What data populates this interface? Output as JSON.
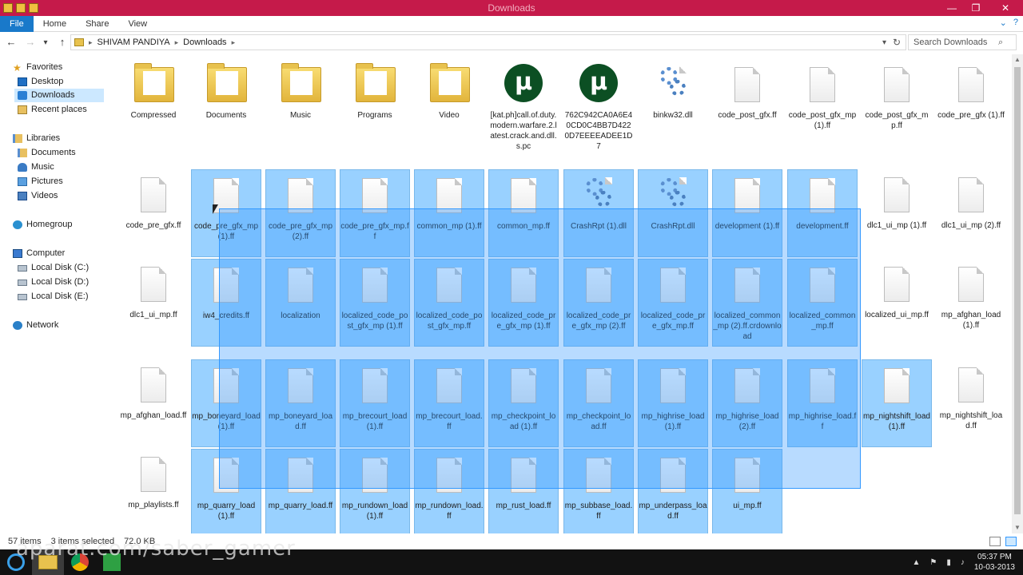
{
  "window": {
    "title": "Downloads",
    "buttons": {
      "minimize": "—",
      "maximize": "❐",
      "close": "✕"
    }
  },
  "ribbon": {
    "tabs": [
      "File",
      "Home",
      "Share",
      "View"
    ]
  },
  "address": {
    "crumbs": [
      "SHIVAM PANDIYA",
      "Downloads"
    ],
    "search_placeholder": "Search Downloads"
  },
  "nav": {
    "favorites": "Favorites",
    "desktop": "Desktop",
    "downloads": "Downloads",
    "recent": "Recent places",
    "libraries": "Libraries",
    "documents": "Documents",
    "music": "Music",
    "pictures": "Pictures",
    "videos": "Videos",
    "homegroup": "Homegroup",
    "computer": "Computer",
    "drive_c": "Local Disk (C:)",
    "drive_d": "Local Disk (D:)",
    "drive_e": "Local Disk (E:)",
    "network": "Network"
  },
  "files": [
    {
      "label": "Compressed",
      "icon": "folder-icon"
    },
    {
      "label": "Documents",
      "icon": "folder-icon"
    },
    {
      "label": "Music",
      "icon": "folder-icon"
    },
    {
      "label": "Programs",
      "icon": "folder-icon"
    },
    {
      "label": "Video",
      "icon": "folder-icon"
    },
    {
      "label": "[kat.ph]call.of.duty.modern.warfare.2.latest.crack.and.dll.s.pc",
      "icon": "utorrent-icon"
    },
    {
      "label": "762C942CA0A6E40CD0C4BB7D4220D7EEEEADEE1D7",
      "icon": "utorrent-icon"
    },
    {
      "label": "binkw32.dll",
      "icon": "settings-gear-icon"
    },
    {
      "label": "code_post_gfx.ff",
      "icon": "file-icon"
    },
    {
      "label": "code_post_gfx_mp (1).ff",
      "icon": "file-icon"
    },
    {
      "label": "code_post_gfx_mp.ff",
      "icon": "file-icon"
    },
    {
      "label": "code_pre_gfx (1).ff",
      "icon": "file-icon"
    },
    {
      "label": "code_pre_gfx.ff",
      "icon": "file-icon"
    },
    {
      "label": "code_pre_gfx_mp (1).ff",
      "icon": "file-icon"
    },
    {
      "label": "code_pre_gfx_mp (2).ff",
      "icon": "file-icon"
    },
    {
      "label": "code_pre_gfx_mp.ff",
      "icon": "file-icon"
    },
    {
      "label": "common_mp (1).ff",
      "icon": "file-icon"
    },
    {
      "label": "common_mp.ff",
      "icon": "file-icon"
    },
    {
      "label": "CrashRpt (1).dll",
      "icon": "settings-gear-icon"
    },
    {
      "label": "CrashRpt.dll",
      "icon": "settings-gear-icon"
    },
    {
      "label": "development (1).ff",
      "icon": "file-icon"
    },
    {
      "label": "development.ff",
      "icon": "file-icon"
    },
    {
      "label": "dlc1_ui_mp (1).ff",
      "icon": "file-icon"
    },
    {
      "label": "dlc1_ui_mp (2).ff",
      "icon": "file-icon"
    },
    {
      "label": "dlc1_ui_mp.ff",
      "icon": "file-icon"
    },
    {
      "label": "iw4_credits.ff",
      "icon": "file-icon"
    },
    {
      "label": "localization",
      "icon": "file-icon"
    },
    {
      "label": "localized_code_post_gfx_mp (1).ff",
      "icon": "file-icon"
    },
    {
      "label": "localized_code_post_gfx_mp.ff",
      "icon": "file-icon"
    },
    {
      "label": "localized_code_pre_gfx_mp (1).ff",
      "icon": "file-icon"
    },
    {
      "label": "localized_code_pre_gfx_mp (2).ff",
      "icon": "file-icon"
    },
    {
      "label": "localized_code_pre_gfx_mp.ff",
      "icon": "file-icon"
    },
    {
      "label": "localized_common_mp (2).ff.crdownload",
      "icon": "file-icon"
    },
    {
      "label": "localized_common_mp.ff",
      "icon": "file-icon"
    },
    {
      "label": "localized_ui_mp.ff",
      "icon": "file-icon"
    },
    {
      "label": "mp_afghan_load (1).ff",
      "icon": "file-icon"
    },
    {
      "label": "mp_afghan_load.ff",
      "icon": "file-icon"
    },
    {
      "label": "mp_boneyard_load (1).ff",
      "icon": "file-icon"
    },
    {
      "label": "mp_boneyard_load.ff",
      "icon": "file-icon"
    },
    {
      "label": "mp_brecourt_load (1).ff",
      "icon": "file-icon"
    },
    {
      "label": "mp_brecourt_load.ff",
      "icon": "file-icon"
    },
    {
      "label": "mp_checkpoint_load (1).ff",
      "icon": "file-icon"
    },
    {
      "label": "mp_checkpoint_load.ff",
      "icon": "file-icon"
    },
    {
      "label": "mp_highrise_load (1).ff",
      "icon": "file-icon"
    },
    {
      "label": "mp_highrise_load (2).ff",
      "icon": "file-icon"
    },
    {
      "label": "mp_highrise_load.ff",
      "icon": "file-icon"
    },
    {
      "label": "mp_nightshift_load (1).ff",
      "icon": "file-icon"
    },
    {
      "label": "mp_nightshift_load.ff",
      "icon": "file-icon"
    },
    {
      "label": "mp_playlists.ff",
      "icon": "file-icon"
    },
    {
      "label": "mp_quarry_load (1).ff",
      "icon": "file-icon"
    },
    {
      "label": "mp_quarry_load.ff",
      "icon": "file-icon"
    },
    {
      "label": "mp_rundown_load (1).ff",
      "icon": "file-icon"
    },
    {
      "label": "mp_rundown_load.ff",
      "icon": "file-icon"
    },
    {
      "label": "mp_rust_load.ff",
      "icon": "file-icon"
    },
    {
      "label": "mp_subbase_load.ff",
      "icon": "file-icon"
    },
    {
      "label": "mp_underpass_load.ff",
      "icon": "file-icon"
    },
    {
      "label": "ui_mp.ff",
      "icon": "file-icon"
    }
  ],
  "selected_indices": [
    13,
    14,
    15,
    16,
    17,
    18,
    19,
    20,
    21,
    25,
    26,
    27,
    28,
    29,
    30,
    31,
    32,
    33,
    37,
    38,
    39,
    40,
    41,
    42,
    43,
    44,
    45,
    46,
    49,
    50,
    51,
    52,
    53,
    54,
    55,
    56
  ],
  "status": {
    "items": "57 items",
    "selected": "3 items selected",
    "size": "72.0 KB"
  },
  "taskbar": {
    "watermark": "aparat.com/saber_gamer",
    "time": "05:37 PM",
    "date": "10-03-2013"
  },
  "colors": {
    "title_bar": "#c51a4a",
    "selection": "#99d1ff",
    "accent": "#1979ca"
  }
}
